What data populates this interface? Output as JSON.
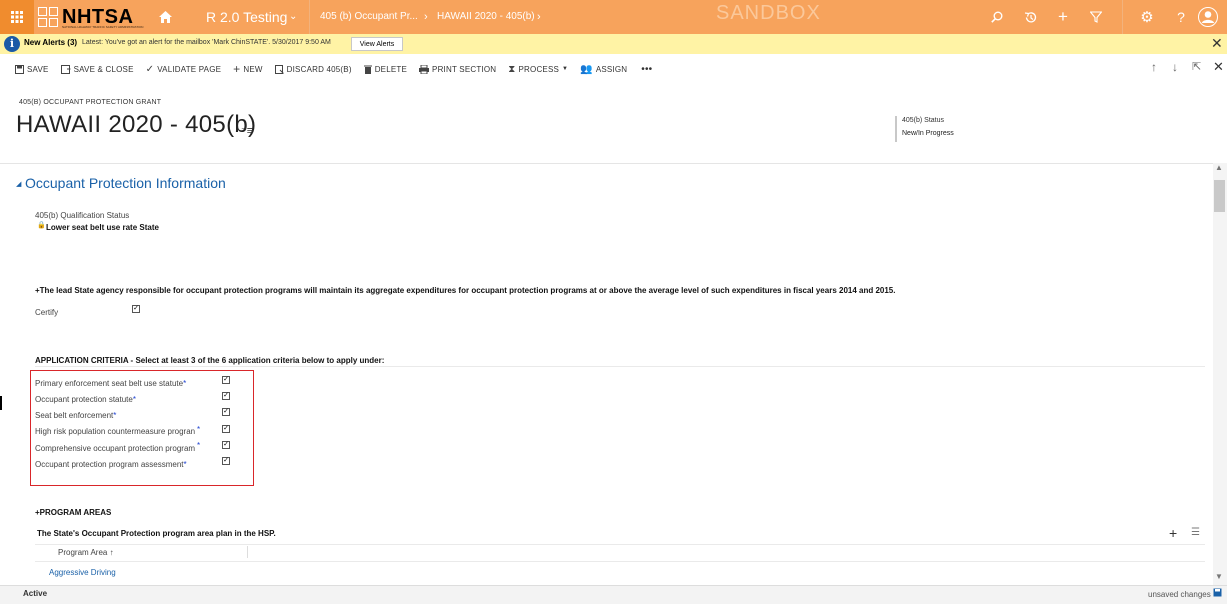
{
  "nav": {
    "app_grid_icon": "app-grid-icon",
    "logo_text": "NHTSA",
    "logo_subtext": "NATIONAL HIGHWAY TRAFFIC SAFETY ADMINISTRATION",
    "home_icon": "home-icon",
    "app_name": "R 2.0 Testing",
    "crumb1": "405 (b) Occupant Pr...",
    "crumb2": "HAWAII 2020 - 405(b)",
    "sandbox": "SANDBOX",
    "bg_color": "#f7a35c"
  },
  "alert": {
    "title": "New Alerts (3)",
    "message": "Latest: You've got an alert for the mailbox 'Mark ChinSTATE'. 5/30/2017 9:50 AM",
    "button": "View Alerts",
    "close": "✕"
  },
  "commands": [
    {
      "label": "SAVE",
      "icon": "save-icon"
    },
    {
      "label": "SAVE & CLOSE",
      "icon": "save-close-icon"
    },
    {
      "label": "VALIDATE PAGE",
      "icon": "validate-icon"
    },
    {
      "label": "NEW",
      "icon": "plus-icon"
    },
    {
      "label": "DISCARD 405(B)",
      "icon": "discard-icon"
    },
    {
      "label": "DELETE",
      "icon": "trash-icon"
    },
    {
      "label": "PRINT SECTION",
      "icon": "print-icon"
    },
    {
      "label": "PROCESS",
      "icon": "process-icon"
    },
    {
      "label": "ASSIGN",
      "icon": "assign-icon"
    },
    {
      "label": "•••",
      "icon": "more-icon"
    }
  ],
  "header": {
    "entity": "405(B) OCCUPANT PROTECTION GRANT",
    "title": "HAWAII 2020 - 405(b)",
    "status_label": "405(b) Status",
    "status_value": "New/In Progress"
  },
  "section": {
    "title": "Occupant Protection Information",
    "qual_label": "405(b) Qualification Status",
    "qual_value": "Lower seat belt use rate State",
    "maintain_statement": "+The lead State agency responsible for occupant protection programs will maintain its aggregate expenditures for occupant protection programs at or above the average level of such expenditures in fiscal years 2014 and 2015.",
    "certify_label": "Certify",
    "criteria_heading": "APPLICATION CRITERIA - Select at least 3 of the 6 application criteria below to apply under:",
    "criteria": [
      {
        "label": "Primary enforcement seat belt use statute",
        "checked": true
      },
      {
        "label": "Occupant protection statute",
        "checked": true
      },
      {
        "label": "Seat belt enforcement",
        "checked": true
      },
      {
        "label": "High risk population countermeasure progran",
        "checked": true
      },
      {
        "label": "Comprehensive occupant protection program",
        "checked": true
      },
      {
        "label": "Occupant protection program assessment",
        "checked": true
      }
    ],
    "program_areas_heading": "+PROGRAM AREAS",
    "program_plan_label": "The State's Occupant Protection program area plan in the HSP.",
    "grid_column": "Program Area ↑",
    "grid_rows": [
      "Aggressive Driving"
    ]
  },
  "statusbar": {
    "state": "Active",
    "unsaved": "unsaved changes"
  },
  "colors": {
    "accent_blue": "#1a61a8",
    "alert_yellow": "#fff3a5",
    "highlight_red": "#d9262a"
  }
}
